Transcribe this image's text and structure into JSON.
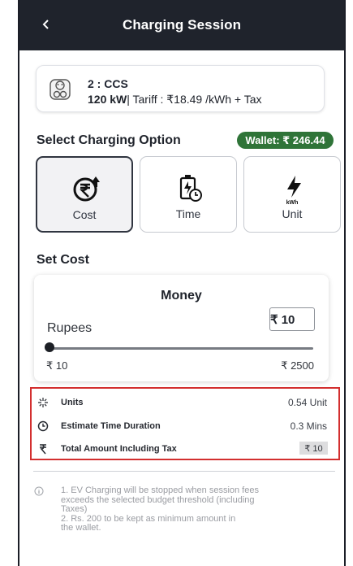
{
  "header": {
    "title": "Charging Session"
  },
  "charger": {
    "connector": "2 : CCS",
    "power": "120 kW",
    "details": "| Tariff : ₹18.49 /kWh + Tax"
  },
  "charging_options": {
    "title": "Select Charging Option",
    "wallet": "Wallet: ₹ 246.44",
    "items": [
      {
        "label": "Cost",
        "icon": "rupee-up-icon",
        "selected": true
      },
      {
        "label": "Time",
        "icon": "battery-clock-icon",
        "selected": false
      },
      {
        "label": "Unit",
        "icon": "kwh-bolt-icon",
        "selected": false,
        "icon_caption": "kWh"
      }
    ]
  },
  "cost_setting": {
    "title": "Set Cost",
    "money_title": "Money",
    "amount": "₹ 10",
    "rupees_label": "Rupees",
    "minimum": "₹ 10",
    "maximum": "₹ 2500",
    "slider_value": 0
  },
  "summary": [
    {
      "label": "Units",
      "value": "0.54 Unit",
      "icon": "sparkle-icon"
    },
    {
      "label": "Estimate Time Duration",
      "value": "0.3 Mins",
      "icon": "clock-icon"
    },
    {
      "label": "Total Amount Including Tax",
      "value": "₹ 10",
      "icon": "rupee-icon"
    }
  ],
  "note": {
    "text": "1. EV Charging will be stopped when session fees\nexceeds the selected budget threshold (including\nTaxes)\n 2. Rs. 200 to be kept as minimum amount in\nthe wallet."
  },
  "colors": {
    "header": "#1f232c",
    "wallet": "#2f7438",
    "highlight": "#d32f2f"
  }
}
